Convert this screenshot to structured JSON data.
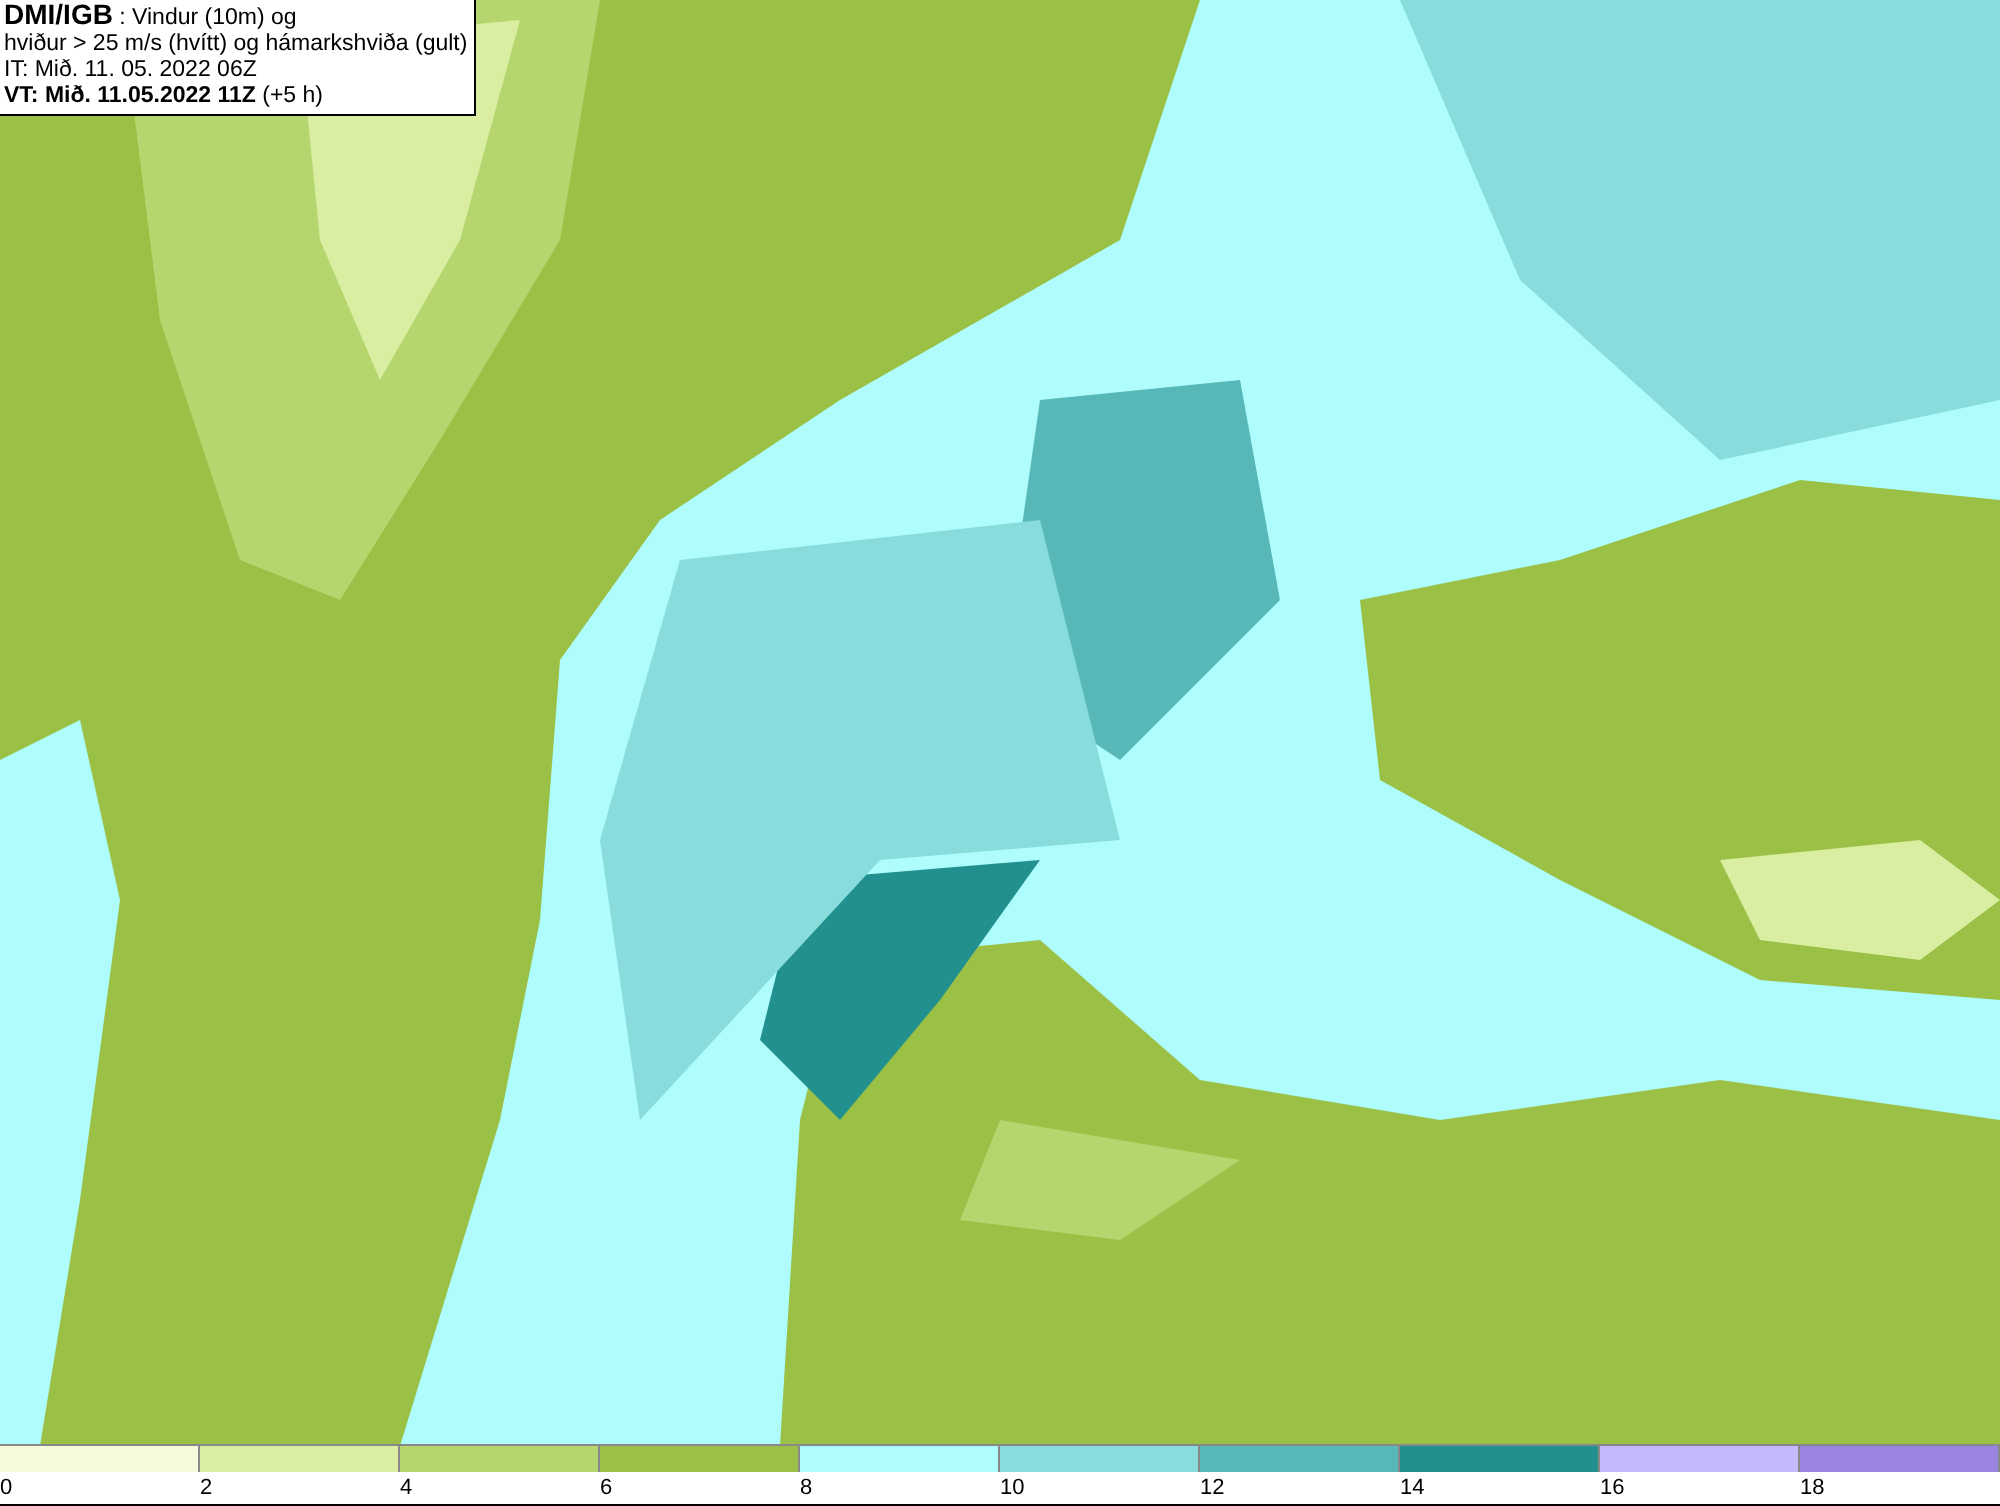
{
  "title_box": {
    "lines": [
      "**DMI/IGB** : Vindur (10m) og",
      "hviður > 25 m/s (hvítt) og hámarkshviða (gult)",
      "IT: Mið. 11. 05. 2022 06Z",
      "**VT: Mið. 11.05.2022 11Z** (+5 h)"
    ]
  },
  "legend": {
    "bins": [
      {
        "label": "0",
        "color": "#f5fadc"
      },
      {
        "label": "2",
        "color": "#d9eea0"
      },
      {
        "label": "4",
        "color": "#b5d66e"
      },
      {
        "label": "6",
        "color": "#9ac046"
      },
      {
        "label": "8",
        "color": "#aefcfc"
      },
      {
        "label": "10",
        "color": "#88dcdc"
      },
      {
        "label": "12",
        "color": "#58b8b8"
      },
      {
        "label": "14",
        "color": "#239090"
      },
      {
        "label": "16",
        "color": "#c6b8fc"
      },
      {
        "label": "18",
        "color": "#9b84e0"
      }
    ]
  }
}
